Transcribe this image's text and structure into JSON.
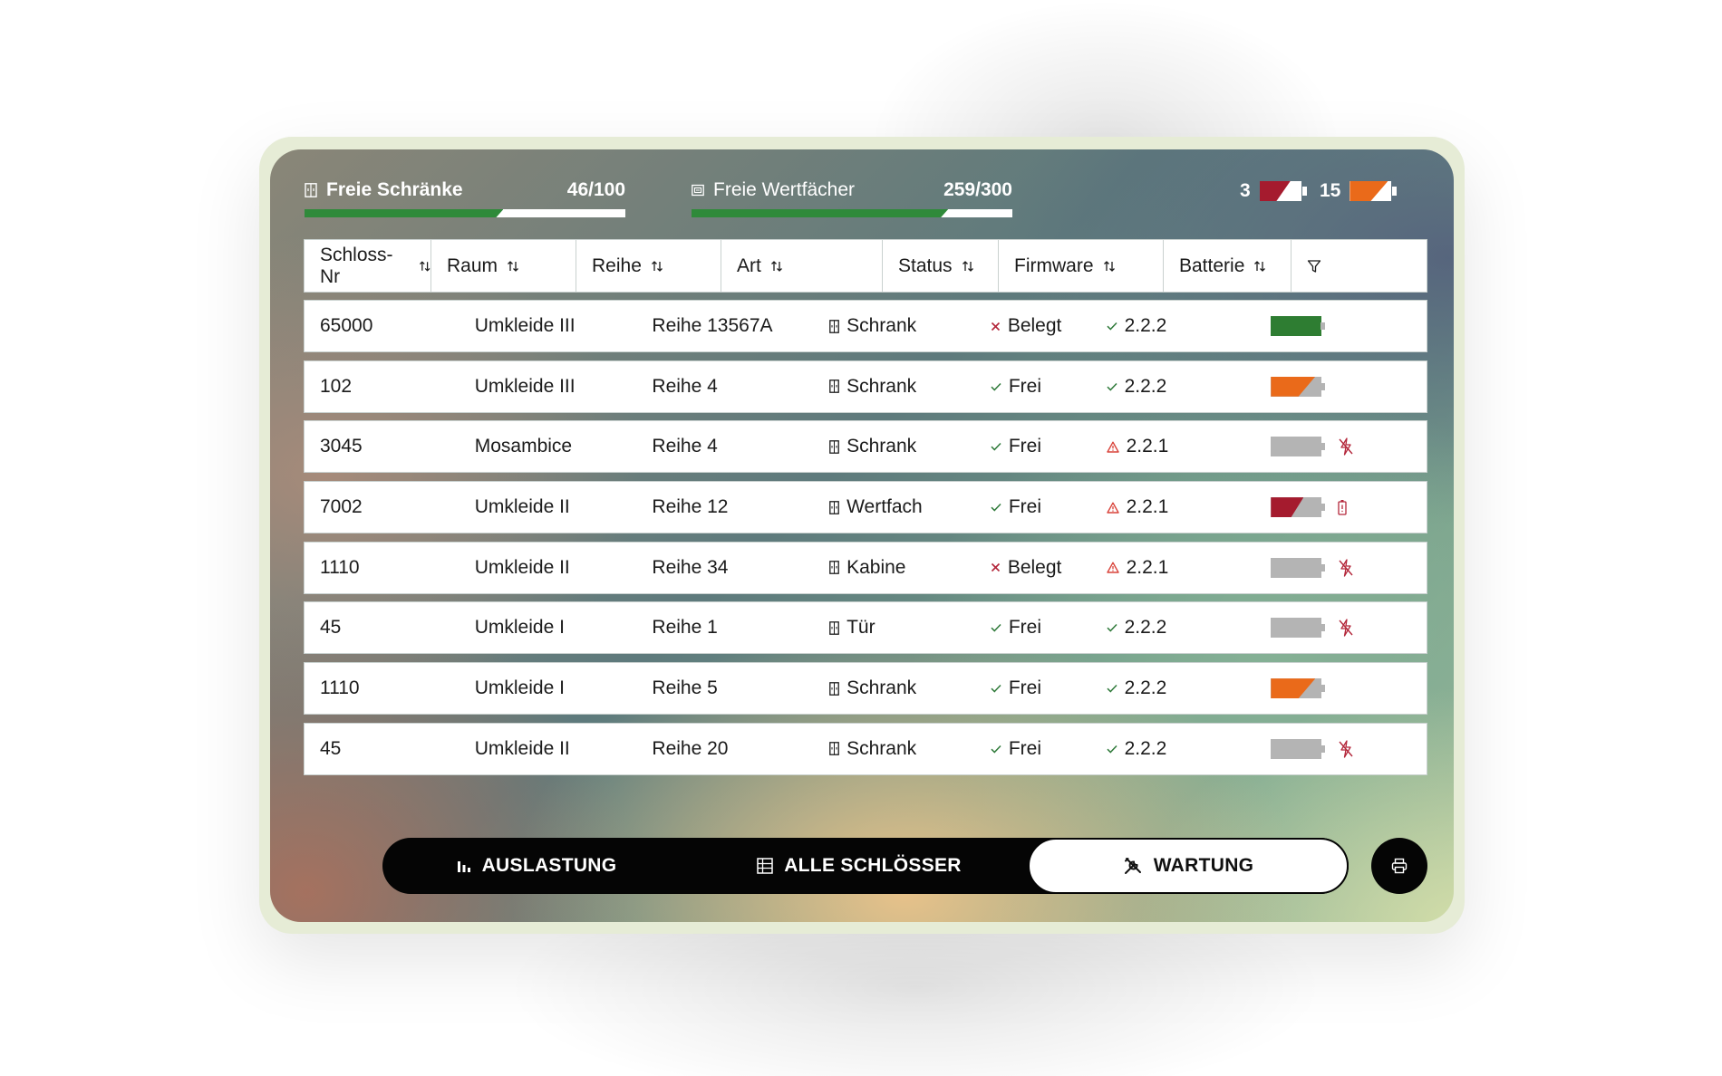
{
  "stats": {
    "schraenke": {
      "label": "Freie Schränke",
      "count": "46/100",
      "fill": 0.62
    },
    "wertfaecher": {
      "label": "Freie Wertfächer",
      "count": "259/300",
      "fill": 0.8
    }
  },
  "battery_summary": {
    "critical": {
      "count": "3",
      "color": "#a51b2e"
    },
    "low": {
      "count": "15",
      "color": "#ea6a1a"
    }
  },
  "table": {
    "headers": {
      "nr": "Schloss-Nr",
      "raum": "Raum",
      "reihe": "Reihe",
      "art": "Art",
      "status": "Status",
      "firmware": "Firmware",
      "batterie": "Batterie"
    },
    "rows": [
      {
        "nr": "65000",
        "raum": "Umkleide III",
        "reihe": "Reihe 13567A",
        "art": "Schrank",
        "status": "Belegt",
        "status_ok": false,
        "firmware": "2.2.2",
        "fw_ok": true,
        "battery": "full",
        "battery_level": 1.0,
        "battery_alert": ""
      },
      {
        "nr": "102",
        "raum": "Umkleide III",
        "reihe": "Reihe 4",
        "art": "Schrank",
        "status": "Frei",
        "status_ok": true,
        "firmware": "2.2.2",
        "fw_ok": true,
        "battery": "low",
        "battery_level": 0.55,
        "battery_alert": ""
      },
      {
        "nr": "3045",
        "raum": "Mosambice",
        "reihe": "Reihe 4",
        "art": "Schrank",
        "status": "Frei",
        "status_ok": true,
        "firmware": "2.2.1",
        "fw_ok": false,
        "battery": "empty",
        "battery_level": 0.0,
        "battery_alert": "no-power"
      },
      {
        "nr": "7002",
        "raum": "Umkleide II",
        "reihe": "Reihe 12",
        "art": "Wertfach",
        "status": "Frei",
        "status_ok": true,
        "firmware": "2.2.1",
        "fw_ok": false,
        "battery": "critical",
        "battery_level": 0.4,
        "battery_alert": "battery-warning"
      },
      {
        "nr": "1110",
        "raum": "Umkleide II",
        "reihe": "Reihe 34",
        "art": "Kabine",
        "status": "Belegt",
        "status_ok": false,
        "firmware": "2.2.1",
        "fw_ok": false,
        "battery": "empty",
        "battery_level": 0.0,
        "battery_alert": "no-power"
      },
      {
        "nr": "45",
        "raum": "Umkleide I",
        "reihe": "Reihe 1",
        "art": "Tür",
        "status": "Frei",
        "status_ok": true,
        "firmware": "2.2.2",
        "fw_ok": true,
        "battery": "empty",
        "battery_level": 0.0,
        "battery_alert": "no-power"
      },
      {
        "nr": "1110",
        "raum": "Umkleide I",
        "reihe": "Reihe 5",
        "art": "Schrank",
        "status": "Frei",
        "status_ok": true,
        "firmware": "2.2.2",
        "fw_ok": true,
        "battery": "low",
        "battery_level": 0.55,
        "battery_alert": ""
      },
      {
        "nr": "45",
        "raum": "Umkleide II",
        "reihe": "Reihe 20",
        "art": "Schrank",
        "status": "Frei",
        "status_ok": true,
        "firmware": "2.2.2",
        "fw_ok": true,
        "battery": "empty",
        "battery_level": 0.0,
        "battery_alert": "no-power"
      }
    ]
  },
  "colors": {
    "full": "#2e7d32",
    "low": "#ea6a1a",
    "critical": "#a51b2e",
    "empty_shell": "#b4b4b4",
    "ok_check": "#2f7a3a",
    "error_x": "#b3263a",
    "warn": "#d9433a"
  },
  "nav": {
    "auslastung": "AUSLASTUNG",
    "alle": "ALLE SCHLÖSSER",
    "wartung": "WARTUNG",
    "active": "wartung"
  },
  "icons": {
    "stat1": "locker-icon",
    "stat2": "safe-box-icon",
    "sort": "sort-arrows-icon",
    "filter": "filter-icon",
    "print": "printer-icon"
  }
}
